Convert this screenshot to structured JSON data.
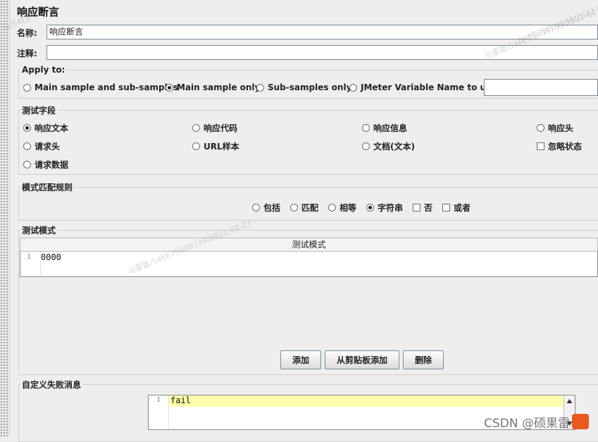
{
  "window": {
    "title": "响应断言"
  },
  "name_field": {
    "label": "名称:",
    "value": "响应断言"
  },
  "comment_field": {
    "label": "注释:",
    "value": ""
  },
  "apply_to": {
    "legend": "Apply to:",
    "options": [
      {
        "label": "Main sample and sub-samples",
        "selected": false
      },
      {
        "label": "Main sample only",
        "selected": true
      },
      {
        "label": "Sub-samples only",
        "selected": false
      },
      {
        "label": "JMeter Variable Name to use",
        "selected": false
      }
    ],
    "variable_value": ""
  },
  "field_to_test": {
    "legend": "测试字段",
    "options": [
      {
        "label": "响应文本",
        "selected": true
      },
      {
        "label": "响应代码",
        "selected": false
      },
      {
        "label": "响应信息",
        "selected": false
      },
      {
        "label": "响应头",
        "selected": false
      },
      {
        "label": "请求头",
        "selected": false
      },
      {
        "label": "URL样本",
        "selected": false
      },
      {
        "label": "文档(文本)",
        "selected": false
      },
      {
        "label": "请求数据",
        "selected": false
      }
    ],
    "ignore_status": {
      "label": "忽略状态",
      "checked": false
    }
  },
  "pattern_matching": {
    "legend": "模式匹配规则",
    "options": [
      {
        "label": "包括",
        "selected": false
      },
      {
        "label": "匹配",
        "selected": false
      },
      {
        "label": "相等",
        "selected": false
      },
      {
        "label": "字符串",
        "selected": true
      }
    ],
    "not_checkbox": {
      "label": "否",
      "checked": false
    },
    "or_checkbox": {
      "label": "或者",
      "checked": false
    }
  },
  "patterns": {
    "legend": "测试模式",
    "column_header": "测试模式",
    "rows": [
      {
        "line": "1",
        "text": "0000"
      }
    ],
    "buttons": {
      "add": "添加",
      "add_clipboard": "从剪贴板添加",
      "delete": "删除"
    }
  },
  "failure_message": {
    "legend": "自定义失败消息",
    "lines": [
      {
        "line": "1",
        "text": "fail"
      }
    ]
  },
  "watermark": {
    "text": "马蕾蕾/54EE75609739/2022-02-23",
    "text_top": "54EE75609739/2022-02-",
    "text_top_left": "马/54EE",
    "text_right": "马蕾蕾/54EE75609739/2022-02"
  },
  "csdn_badge": "CSDN @硕果雷"
}
